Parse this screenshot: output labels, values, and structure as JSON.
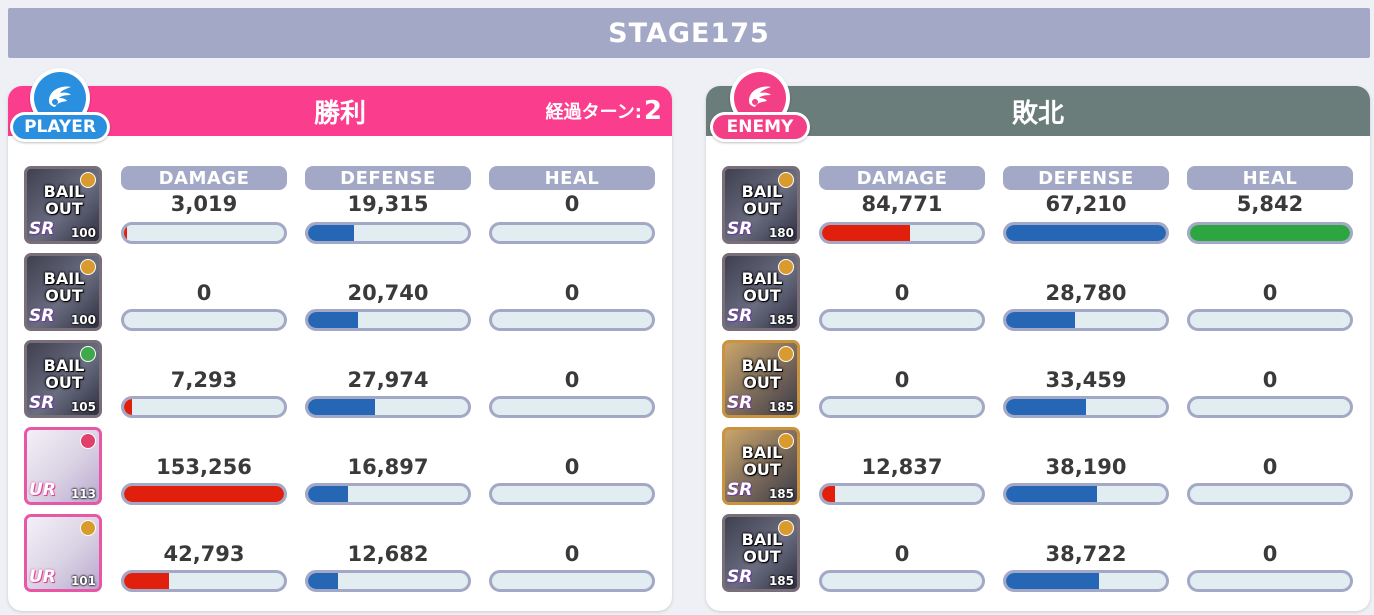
{
  "stage_title": "STAGE175",
  "badge_glyph": "Ɛ",
  "player": {
    "badge_label": "PLAYER",
    "result": "勝利",
    "turns_label": "経過ターン:",
    "turns_value": "2",
    "stat_labels": {
      "damage": "DAMAGE",
      "defense": "DEFENSE",
      "heal": "HEAL"
    },
    "units": [
      {
        "avatar_text": "BAIL\nOUT",
        "rarity": "SR",
        "level": "100",
        "damage": "3,019",
        "defense": "19,315",
        "heal": "0",
        "damage_fill": 0.02,
        "defense_fill": 0.29,
        "heal_fill": 0
      },
      {
        "avatar_text": "BAIL\nOUT",
        "rarity": "SR",
        "level": "100",
        "damage": "0",
        "defense": "20,740",
        "heal": "0",
        "damage_fill": 0,
        "defense_fill": 0.31,
        "heal_fill": 0
      },
      {
        "avatar_text": "BAIL\nOUT",
        "rarity": "SR",
        "level": "105",
        "damage": "7,293",
        "defense": "27,974",
        "heal": "0",
        "damage_fill": 0.05,
        "defense_fill": 0.42,
        "heal_fill": 0
      },
      {
        "avatar_text": "",
        "rarity": "UR",
        "level": "113",
        "damage": "153,256",
        "defense": "16,897",
        "heal": "0",
        "damage_fill": 1.0,
        "defense_fill": 0.25,
        "heal_fill": 0
      },
      {
        "avatar_text": "",
        "rarity": "UR",
        "level": "101",
        "damage": "42,793",
        "defense": "12,682",
        "heal": "0",
        "damage_fill": 0.28,
        "defense_fill": 0.19,
        "heal_fill": 0
      }
    ]
  },
  "enemy": {
    "badge_label": "ENEMY",
    "result": "敗北",
    "stat_labels": {
      "damage": "DAMAGE",
      "defense": "DEFENSE",
      "heal": "HEAL"
    },
    "units": [
      {
        "avatar_text": "BAIL\nOUT",
        "rarity": "SR",
        "level": "180",
        "damage": "84,771",
        "defense": "67,210",
        "heal": "5,842",
        "damage_fill": 0.55,
        "defense_fill": 1.0,
        "heal_fill": 1.0
      },
      {
        "avatar_text": "BAIL\nOUT",
        "rarity": "SR",
        "level": "185",
        "damage": "0",
        "defense": "28,780",
        "heal": "0",
        "damage_fill": 0,
        "defense_fill": 0.43,
        "heal_fill": 0
      },
      {
        "avatar_text": "BAIL\nOUT",
        "rarity": "SR",
        "level": "185",
        "damage": "0",
        "defense": "33,459",
        "heal": "0",
        "damage_fill": 0,
        "defense_fill": 0.5,
        "heal_fill": 0
      },
      {
        "avatar_text": "BAIL\nOUT",
        "rarity": "SR",
        "level": "185",
        "damage": "12,837",
        "defense": "38,190",
        "heal": "0",
        "damage_fill": 0.08,
        "defense_fill": 0.57,
        "heal_fill": 0
      },
      {
        "avatar_text": "BAIL\nOUT",
        "rarity": "SR",
        "level": "185",
        "damage": "0",
        "defense": "38,722",
        "heal": "0",
        "damage_fill": 0,
        "defense_fill": 0.58,
        "heal_fill": 0
      }
    ]
  },
  "colors": {
    "player_accent": "#fb3d8e",
    "enemy_accent": "#6b7d7a",
    "damage": "#e0200c",
    "defense": "#2566b5",
    "heal": "#2da540",
    "label_bg": "#a2a8c6"
  }
}
